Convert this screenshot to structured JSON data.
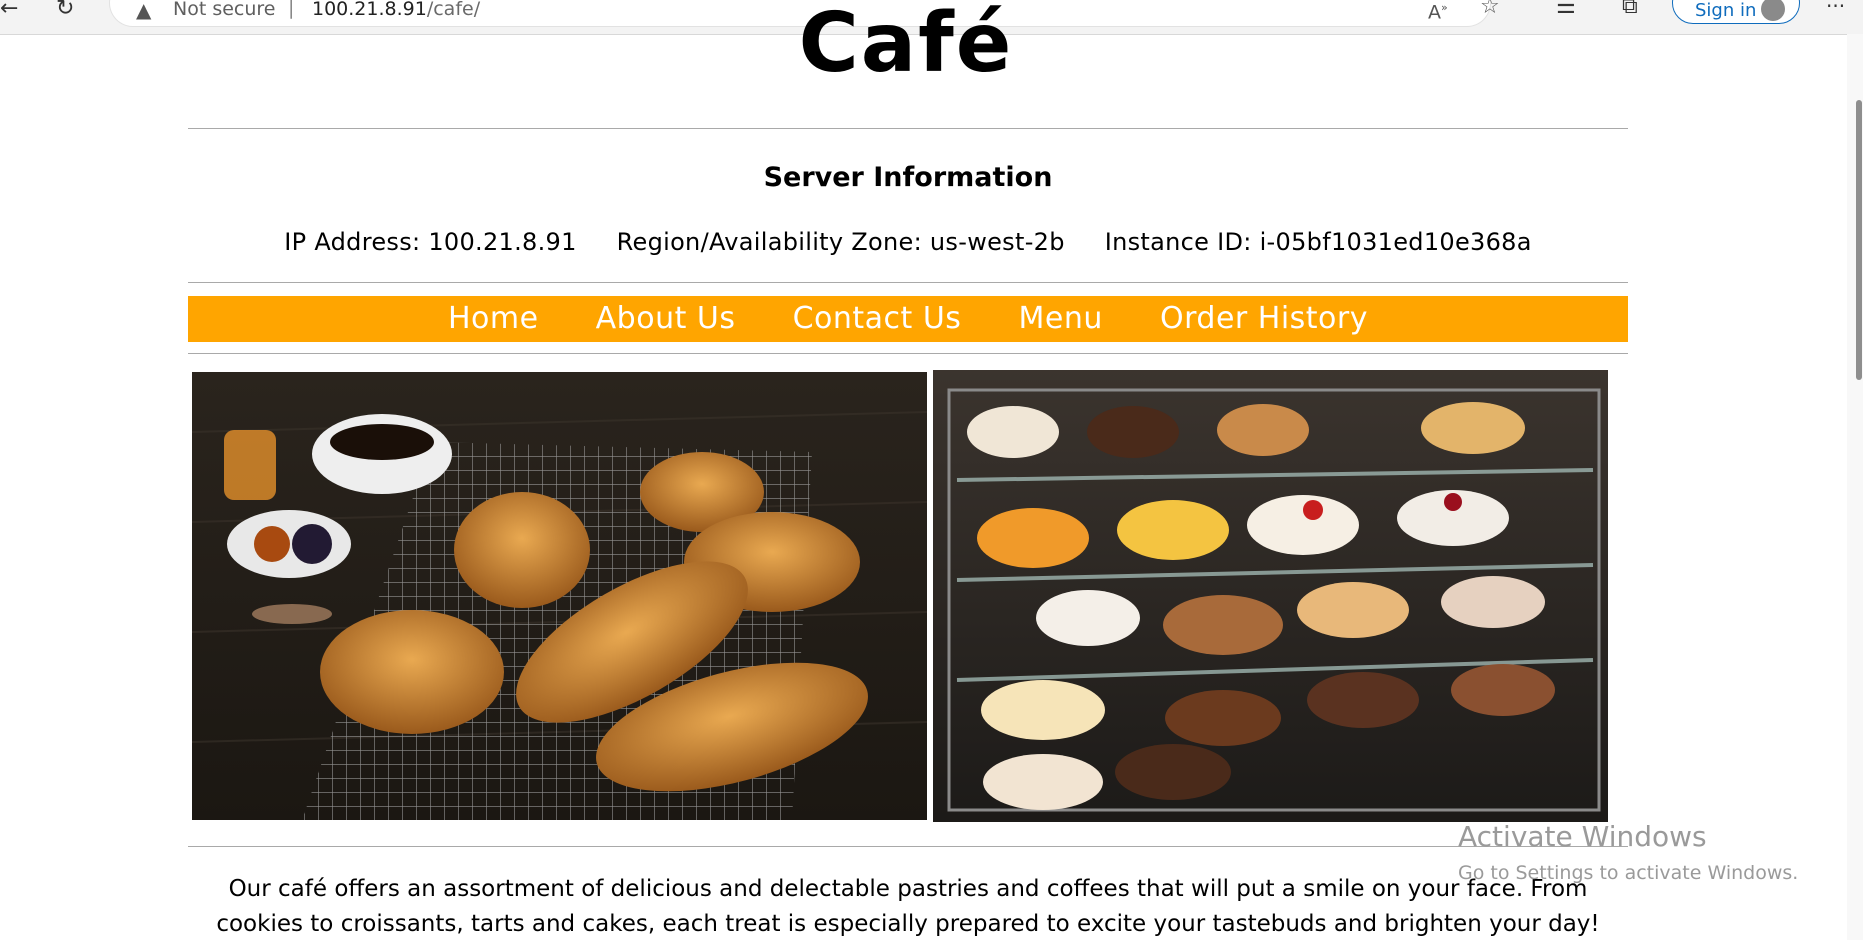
{
  "browser": {
    "security_label": "Not secure",
    "separator": "|",
    "url_host": "100.21.8.91",
    "url_path": "/cafe/",
    "signin_label": "Sign in"
  },
  "page": {
    "logo_text": "Café",
    "server_title": "Server Information",
    "ip_address": "IP Address: 100.21.8.91",
    "region": "Region/Availability Zone: us-west-2b",
    "instance_id": "Instance ID: i-05bf1031ed10e368a",
    "nav": [
      "Home",
      "About Us",
      "Contact Us",
      "Menu",
      "Order History"
    ],
    "description": "Our café offers an assortment of delicious and delectable pastries and coffees that will put a smile on your face. From cookies to croissants, tarts and cakes, each treat is especially prepared to excite your tastebuds and brighten your day!"
  },
  "watermark": {
    "line1": "Activate Windows",
    "line2": "Go to Settings to activate Windows."
  },
  "colors": {
    "nav_bar": "#ffa500",
    "signin_accent": "#0f6cbd"
  },
  "icons": [
    "back-arrow-icon",
    "reload-icon",
    "warning-icon",
    "read-aloud-icon",
    "add-favorite-icon",
    "favorites-icon",
    "collections-icon",
    "profile-avatar-icon",
    "more-icon"
  ]
}
